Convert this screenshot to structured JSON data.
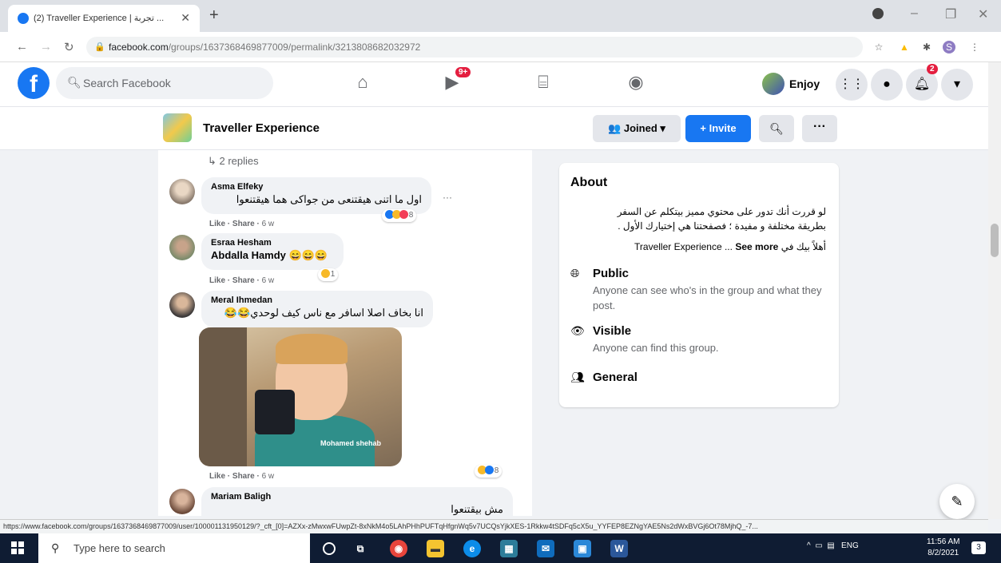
{
  "browser": {
    "tab_title": "(2) Traveller Experience | تجربة ...",
    "tab_close": "✕",
    "new_tab": "+",
    "url_host": "facebook.com",
    "url_path": "/groups/1637368469877009/permalink/3213808682032972",
    "status_url": "https://www.facebook.com/groups/1637368469877009/user/100001131950129/?_cft_[0]=AZXx-zMwxwFUwpZt-8xNkM4o5LAhPHhPUFTqHfgnWq5v7UCQsYjkXES-1Rkkw4tSDFq5cX5u_YYFEP8EZNgYAE5Ns2dWxBVGj6Ot78MjhQ_-7...",
    "win_min": "–",
    "win_max": "❐",
    "win_close": "✕"
  },
  "facebook": {
    "logo": "f",
    "search_placeholder": "Search Facebook",
    "watch_badge": "9+",
    "profile_name": "Enjoy",
    "notif_badge": "2"
  },
  "group": {
    "name": "Traveller Experience",
    "joined_label": "👥 Joined ▾",
    "invite_label": "+ Invite",
    "more_label": "···"
  },
  "comments": {
    "replies_label": "↳ 2 replies",
    "items": [
      {
        "author": "Asma Elfeky",
        "text": "اول ما اتنى هيقتنعى من جواكى هما هيقتنعوا",
        "actions": "Like · Share · ",
        "time": "6 w",
        "reaction_count": "8"
      },
      {
        "author": "Esraa Hesham",
        "text": "Abdalla Hamdy 😄😄😄",
        "actions": "Like · Share · ",
        "time": "6 w",
        "reaction_count": "1"
      },
      {
        "author": "Meral Ihmedan",
        "text": "انا بخاف اصلا اسافر مع ناس كيف لوحدي😂😂",
        "gif_caption": "Mohamed shehab",
        "actions": "Like · Share · ",
        "time": "6 w",
        "reaction_count": "8"
      },
      {
        "author": "Mariam Baligh",
        "text": "مش بيقتنعوا"
      }
    ],
    "more_options": "···"
  },
  "about": {
    "title": "About",
    "desc_line1": "لو قررت أنك تدور على محتوي مميز بيتكلم عن السفر",
    "desc_line2": "بطريقة مختلفة و مفيدة ؛ فصفحتنا هي إختيارك الأول .",
    "desc_line3_prefix": "أهلاً بيك في",
    "desc_line3_brand": "Traveller Experience ...",
    "see_more": "See more",
    "rows": [
      {
        "icon": "globe-icon",
        "title": "Public",
        "desc": "Anyone can see who's in the group and what they post."
      },
      {
        "icon": "eye-icon",
        "title": "Visible",
        "desc": "Anyone can find this group."
      },
      {
        "icon": "people-icon",
        "title": "General",
        "desc": ""
      }
    ]
  },
  "taskbar": {
    "search_placeholder": "Type here to search",
    "tray_lang": "ENG",
    "time": "11:56 AM",
    "date": "8/2/2021",
    "notif_count": "3"
  },
  "colors": {
    "facebook_blue": "#1877f2",
    "badge_red": "#e41e3f",
    "taskbar": "#0f1c33"
  }
}
